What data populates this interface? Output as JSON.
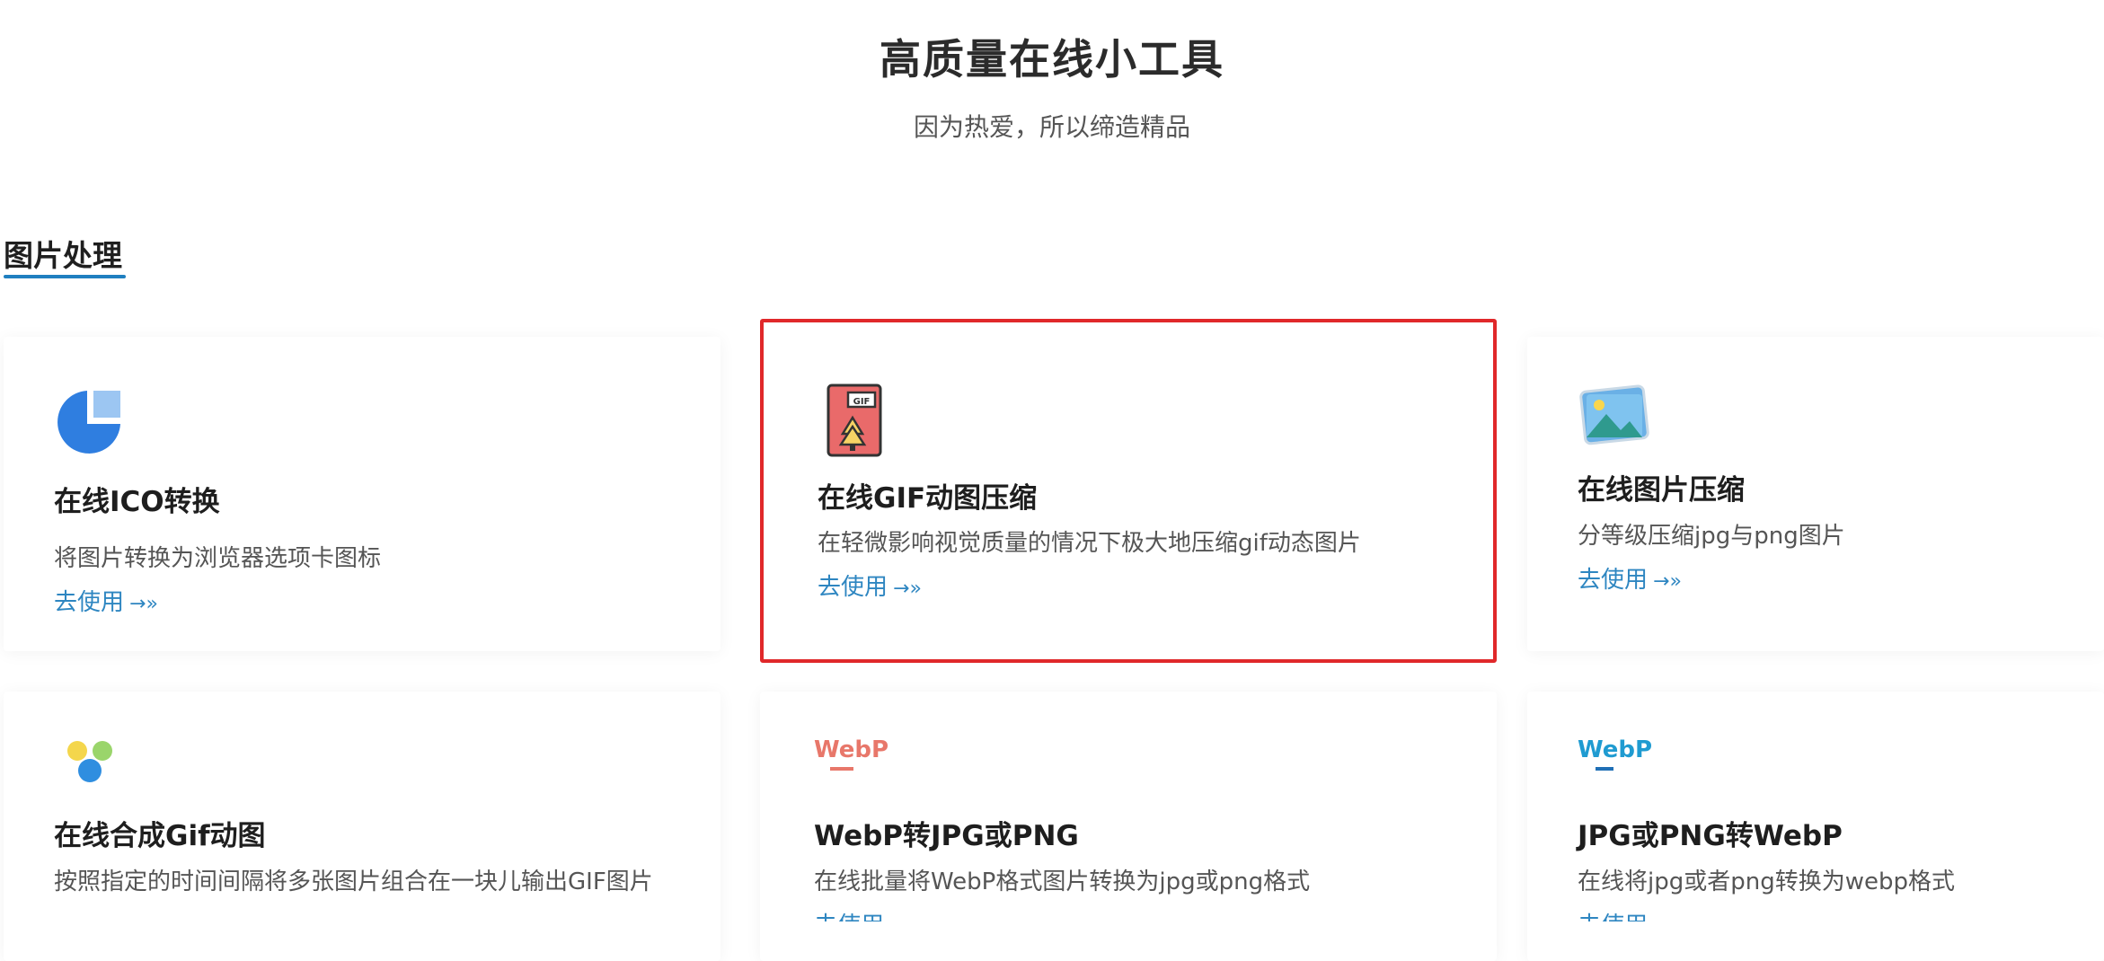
{
  "hero": {
    "title": "高质量在线小工具",
    "subtitle": "因为热爱，所以缔造精品"
  },
  "section": {
    "title": "图片处理",
    "accent_color": "#1f7fc0"
  },
  "cards": [
    {
      "title": "在线ICO转换",
      "desc": "将图片转换为浏览器选项卡图标",
      "link": "去使用",
      "icon": "pie-chart-icon",
      "highlighted": false
    },
    {
      "title": "在线GIF动图压缩",
      "desc": "在轻微影响视觉质量的情况下极大地压缩gif动态图片",
      "link": "去使用",
      "icon": "gif-file-icon",
      "highlighted": true
    },
    {
      "title": "在线图片压缩",
      "desc": "分等级压缩jpg与png图片",
      "link": "去使用",
      "icon": "image-icon",
      "highlighted": false
    },
    {
      "title": "在线合成Gif动图",
      "desc": "按照指定的时间间隔将多张图片组合在一块儿输出GIF图片",
      "link": "去使用",
      "icon": "dots-icon",
      "highlighted": false
    },
    {
      "title": "WebP转JPG或PNG",
      "desc": "在线批量将WebP格式图片转换为jpg或png格式",
      "link": "去使用",
      "icon": "webp-red-icon",
      "icon_text": "WebP",
      "highlighted": false
    },
    {
      "title": "JPG或PNG转WebP",
      "desc": "在线将jpg或者png转换为webp格式",
      "link": "去使用",
      "icon": "webp-blue-icon",
      "icon_text": "WebP",
      "highlighted": false
    }
  ],
  "colors": {
    "link": "#2e86c1",
    "highlight_border": "#e0282a"
  }
}
